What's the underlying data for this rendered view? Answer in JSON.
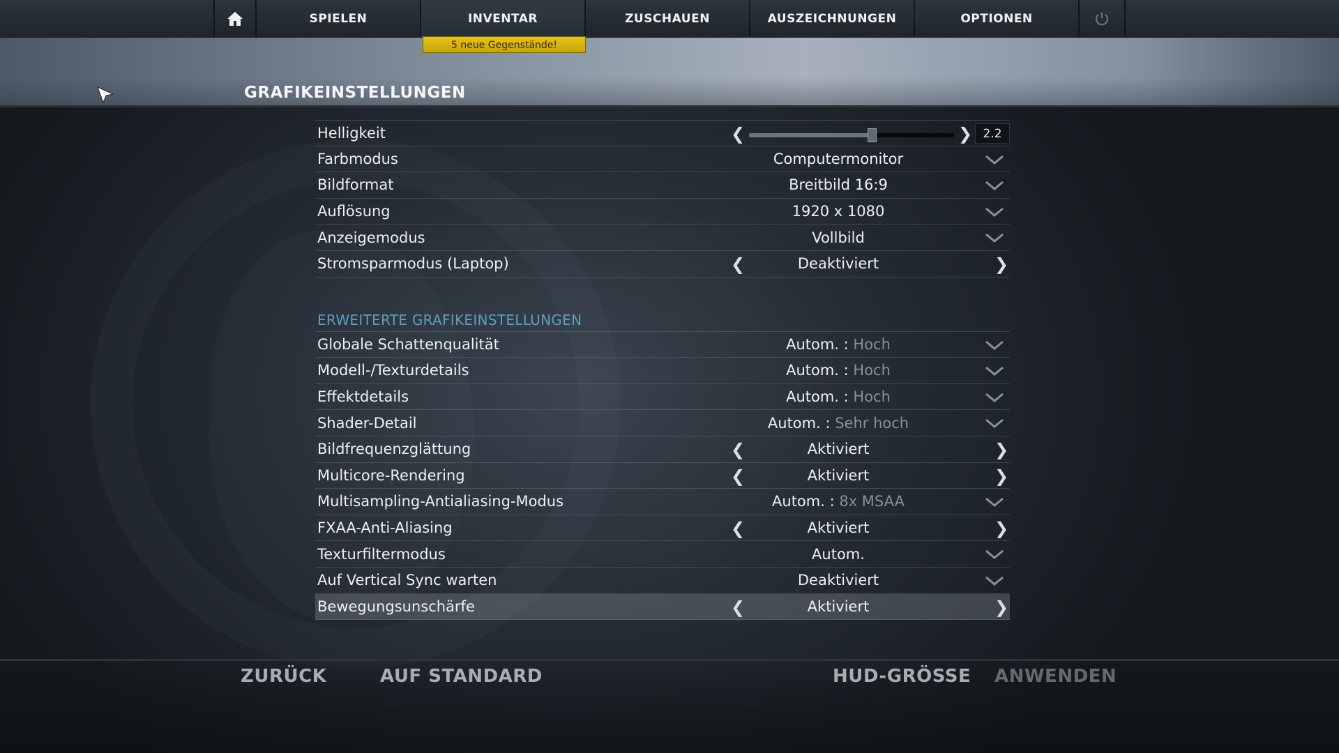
{
  "nav": {
    "home_icon": "home-icon",
    "items": [
      {
        "label": "SPIELEN"
      },
      {
        "label": "INVENTAR"
      },
      {
        "label": "ZUSCHAUEN"
      },
      {
        "label": "AUSZEICHNUNGEN"
      },
      {
        "label": "OPTIONEN"
      }
    ],
    "active": "INVENTAR",
    "power_icon": "power-icon",
    "badge": "5 neue Gegenstände!"
  },
  "page_title": "GRAFIKEINSTELLUNGEN",
  "basic": {
    "brightness": {
      "label": "Helligkeit",
      "value": "2.2",
      "fraction": 0.6
    },
    "rows": [
      {
        "label": "Farbmodus",
        "value": "Computermonitor"
      },
      {
        "label": "Bildformat",
        "value": "Breitbild 16:9"
      },
      {
        "label": "Auflösung",
        "value": "1920 x 1080"
      },
      {
        "label": "Anzeigemodus",
        "value": "Vollbild"
      },
      {
        "label": "Stromsparmodus (Laptop)",
        "value": "Deaktiviert"
      }
    ]
  },
  "advanced": {
    "title": "ERWEITERTE GRAFIKEINSTELLUNGEN",
    "auto_prefix": "Autom. :",
    "rows": [
      {
        "label": "Globale Schattenqualität",
        "detail": "Hoch"
      },
      {
        "label": "Modell-/Texturdetails",
        "detail": "Hoch"
      },
      {
        "label": "Effektdetails",
        "detail": "Hoch"
      },
      {
        "label": "Shader-Detail",
        "detail": "Sehr hoch"
      },
      {
        "label": "Bildfrequenzglättung",
        "value": "Aktiviert"
      },
      {
        "label": "Multicore-Rendering",
        "value": "Aktiviert"
      },
      {
        "label": "Multisampling-Antialiasing-Modus",
        "detail": "8x MSAA"
      },
      {
        "label": "FXAA-Anti-Aliasing",
        "value": "Aktiviert"
      },
      {
        "label": "Texturfiltermodus",
        "value": "Autom."
      },
      {
        "label": "Auf Vertical Sync warten",
        "value": "Deaktiviert"
      },
      {
        "label": "Bewegungsunschärfe",
        "value": "Aktiviert"
      }
    ]
  },
  "arrows": {
    "left": "❮",
    "right": "❯"
  },
  "footer": {
    "back": "ZURÜCK",
    "default": "AUF STANDARD",
    "hud": "HUD-GRÖSSE",
    "apply": "ANWENDEN"
  }
}
